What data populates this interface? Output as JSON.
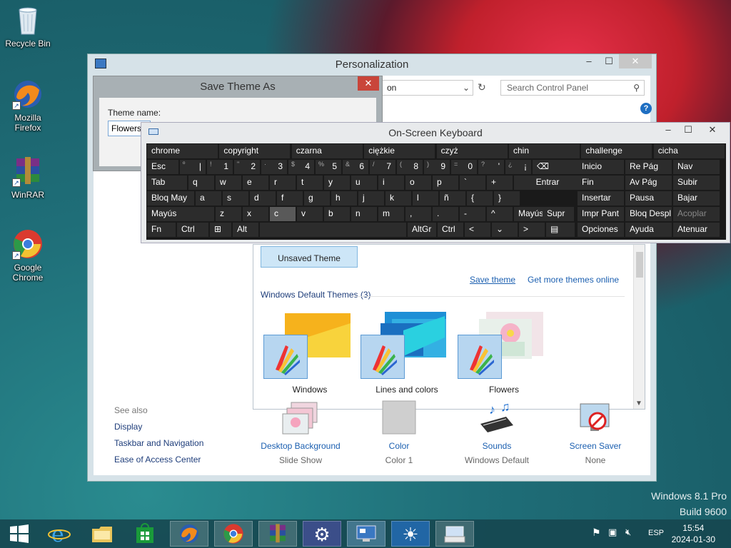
{
  "desktop": {
    "icons": [
      {
        "label": "Recycle Bin"
      },
      {
        "label": "Mozilla Firefox"
      },
      {
        "label": "WinRAR"
      },
      {
        "label": "Google Chrome"
      }
    ],
    "watermark": {
      "line1": "Windows 8.1 Pro",
      "line2": "Build 9600"
    }
  },
  "personalization": {
    "title": "Personalization",
    "address_text": "on",
    "search_placeholder": "Search Control Panel",
    "selected_theme": "Unsaved Theme",
    "save_theme_link": "Save theme",
    "get_more_link": "Get more themes online",
    "default_section": "Windows Default Themes (3)",
    "themes": [
      {
        "label": "Windows"
      },
      {
        "label": "Lines and colors"
      },
      {
        "label": "Flowers"
      }
    ],
    "see_also": {
      "header": "See also",
      "items": [
        "Display",
        "Taskbar and Navigation",
        "Ease of Access Center"
      ]
    },
    "bottom": [
      {
        "name": "Desktop Background",
        "sub": "Slide Show"
      },
      {
        "name": "Color",
        "sub": "Color 1"
      },
      {
        "name": "Sounds",
        "sub": "Windows Default"
      },
      {
        "name": "Screen Saver",
        "sub": "None"
      }
    ]
  },
  "save_dialog": {
    "title": "Save Theme As",
    "label": "Theme name:",
    "value": "Flowers"
  },
  "osk": {
    "title": "On-Screen Keyboard",
    "suggestions": [
      "chrome",
      "copyright",
      "czarna",
      "ciężkie",
      "czyż",
      "chin",
      "challenge",
      "cicha"
    ],
    "row1": [
      {
        "main": "Esc"
      },
      {
        "top": "º",
        "main": "|"
      },
      {
        "top": "!",
        "main": "1"
      },
      {
        "top": "\"",
        "main": "2"
      },
      {
        "top": "·",
        "main": "3"
      },
      {
        "top": "$",
        "main": "4"
      },
      {
        "top": "%",
        "main": "5"
      },
      {
        "top": "&",
        "main": "6"
      },
      {
        "top": "/",
        "main": "7"
      },
      {
        "top": "(",
        "main": "8"
      },
      {
        "top": ")",
        "main": "9"
      },
      {
        "top": "=",
        "main": "0"
      },
      {
        "top": "?",
        "main": "'"
      },
      {
        "top": "¿",
        "main": "¡"
      }
    ],
    "row2": [
      "Tab",
      "q",
      "w",
      "e",
      "r",
      "t",
      "y",
      "u",
      "i",
      "o",
      "p",
      "`",
      "+",
      "Entrar"
    ],
    "row3": [
      "Bloq May",
      "a",
      "s",
      "d",
      "f",
      "g",
      "h",
      "j",
      "k",
      "l",
      "ñ",
      "{",
      "}"
    ],
    "row4": [
      "Mayús",
      "z",
      "x",
      "c",
      "v",
      "b",
      "n",
      "m",
      ",",
      ".",
      "-",
      "^",
      "Mayús"
    ],
    "row5": [
      "Fn",
      "Ctrl",
      "Alt",
      "AltGr",
      "Ctrl",
      "<",
      "⌄",
      ">"
    ],
    "nav": [
      [
        "Inicio",
        "Re Pág",
        "Nav"
      ],
      [
        "Fin",
        "Av Pág",
        "Subir"
      ],
      [
        "Insertar",
        "Pausa",
        "Bajar"
      ],
      [
        "Impr Pant",
        "Bloq Despl",
        "Acoplar"
      ],
      [
        "Opciones",
        "Ayuda",
        "Atenuar"
      ]
    ],
    "supr": "Supr"
  },
  "taskbar": {
    "lang": "ESP",
    "time": "15:54",
    "date": "2024-01-30"
  }
}
